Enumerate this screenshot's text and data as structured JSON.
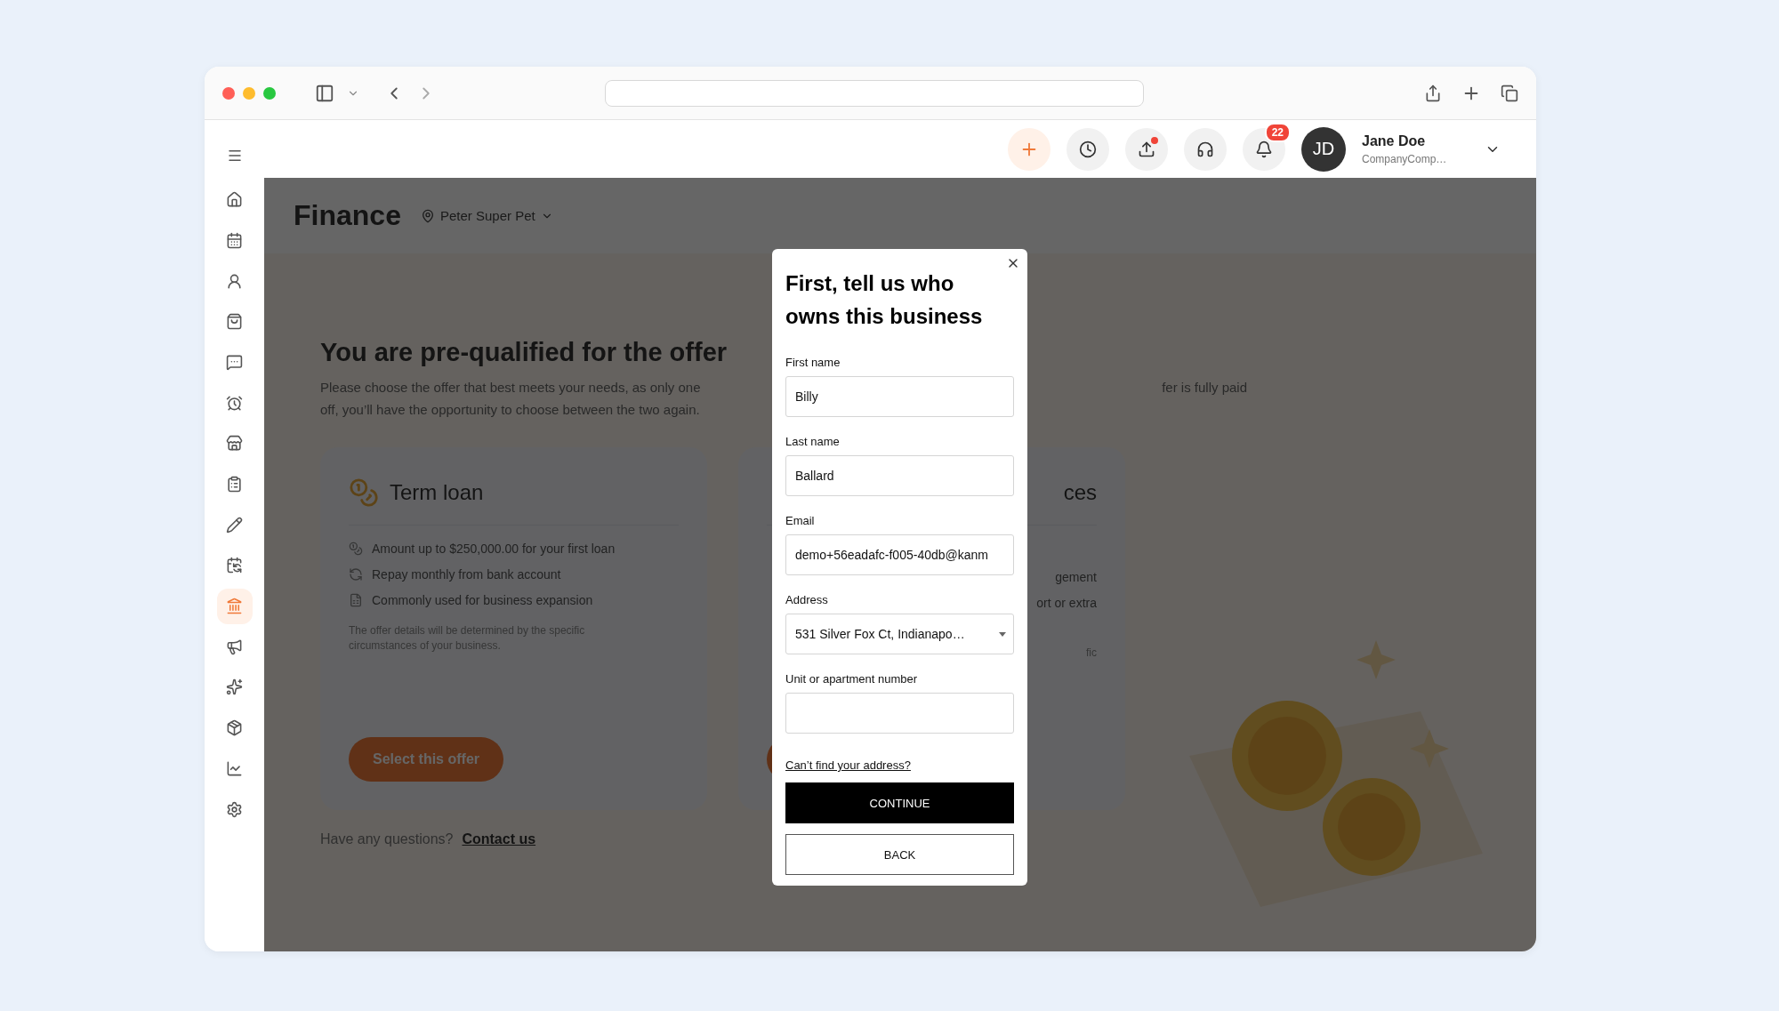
{
  "header": {
    "notifications_count": "22",
    "user": {
      "initials": "JD",
      "name": "Jane Doe",
      "company": "CompanyComp…"
    }
  },
  "sidebar": {
    "items": [
      {
        "selected": false
      },
      {
        "selected": false
      },
      {
        "selected": false
      },
      {
        "selected": false
      },
      {
        "selected": false
      },
      {
        "selected": false
      },
      {
        "selected": false
      },
      {
        "selected": false
      },
      {
        "selected": false
      },
      {
        "selected": false
      },
      {
        "selected": true
      },
      {
        "selected": false
      },
      {
        "selected": false
      },
      {
        "selected": false
      },
      {
        "selected": false
      },
      {
        "selected": false
      }
    ]
  },
  "page": {
    "title": "Finance",
    "location": "Peter Super Pet"
  },
  "offer": {
    "heading": "You are pre-qualified for the offer",
    "intro_lines": [
      "Please choose the offer that best meets your needs, as only one",
      "off, you’ll have the opportunity to choose between the two again."
    ],
    "intro_fragment": "fer is fully paid"
  },
  "cards": [
    {
      "title": "Term loan",
      "features": [
        "Amount up to $250,000.00 for your first loan",
        "Repay monthly from bank account",
        "Commonly used for business expansion"
      ],
      "note": "The offer details will be determined by the specific circumstances of your business.",
      "button": "Select this offer"
    },
    {
      "title_fragment": "ces",
      "feature_fragments": [
        "gement",
        "ort or extra"
      ],
      "note_fragment": "fic"
    }
  ],
  "help": {
    "question": "Have any questions?",
    "link": "Contact us"
  },
  "modal": {
    "title": "First, tell us who owns this business",
    "fields": [
      {
        "kind": "text",
        "label": "First name",
        "value": "Billy"
      },
      {
        "kind": "text",
        "label": "Last name",
        "value": "Ballard"
      },
      {
        "kind": "text",
        "label": "Email",
        "value": "demo+56eadafc-f005-40db@kanm"
      },
      {
        "kind": "select",
        "label": "Address",
        "value": "531 Silver Fox Ct, Indianapo…"
      },
      {
        "kind": "text",
        "label": "Unit or apartment number"
      }
    ],
    "link": "Can’t find your address?",
    "primary_button": "CONTINUE",
    "secondary_button": "BACK"
  }
}
